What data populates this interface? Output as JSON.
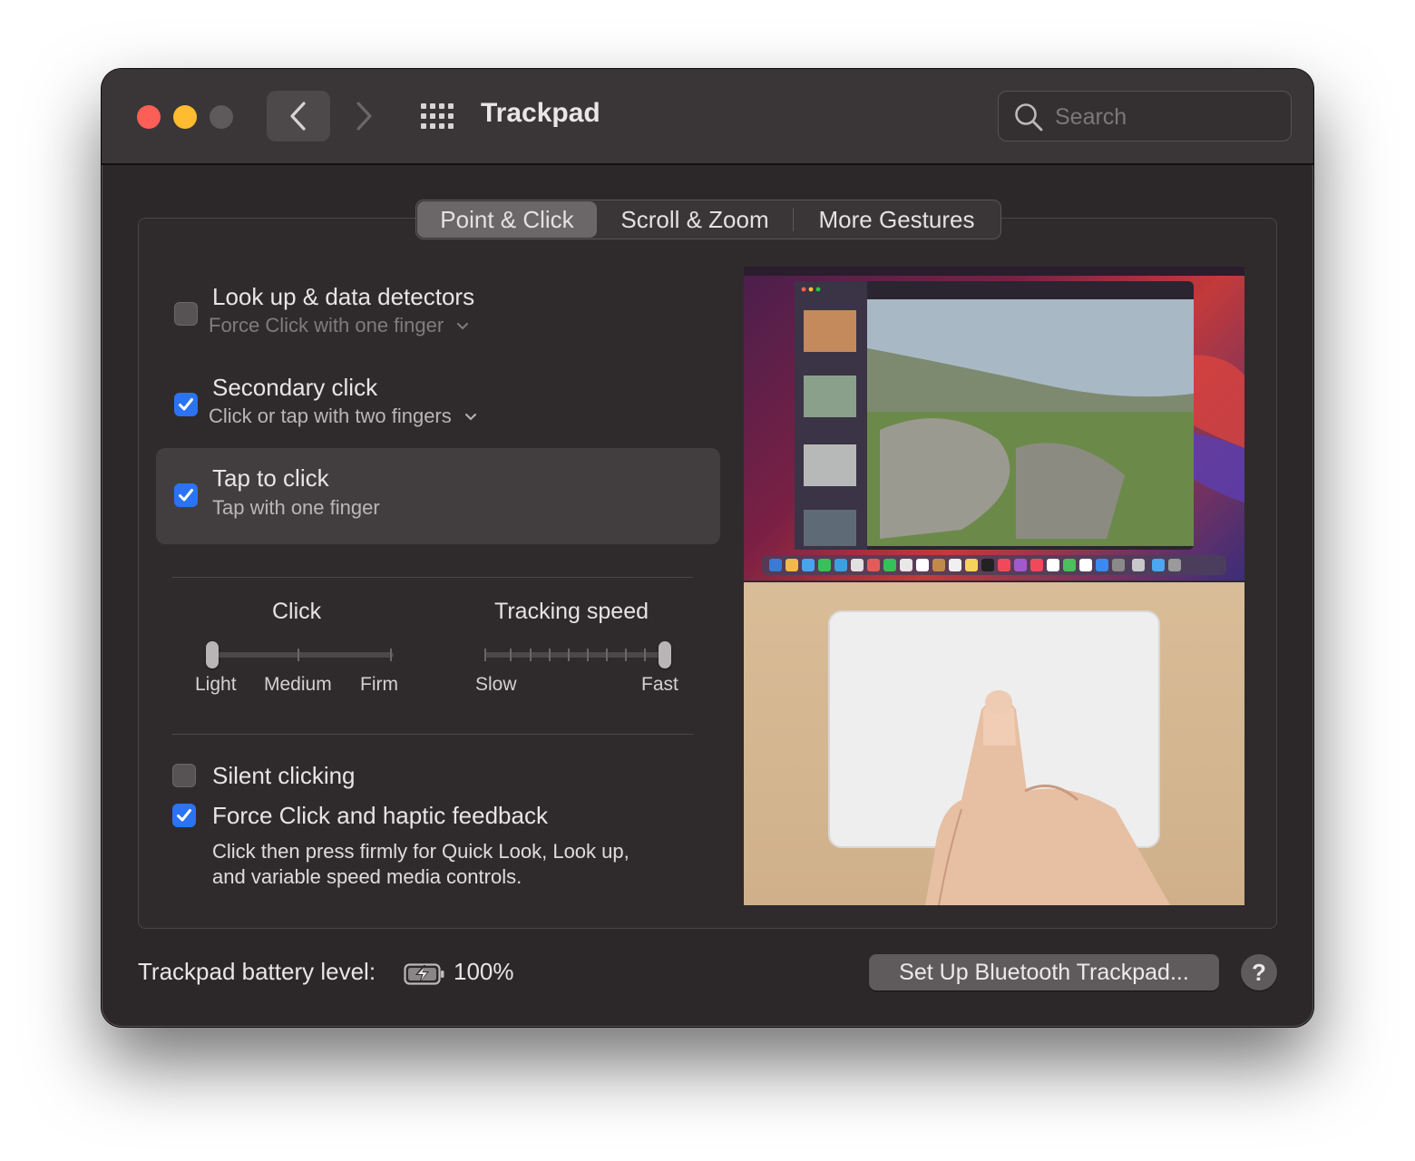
{
  "window": {
    "title": "Trackpad",
    "search": {
      "placeholder": "Search",
      "value": ""
    }
  },
  "tabs": [
    {
      "label": "Point & Click",
      "selected": true
    },
    {
      "label": "Scroll & Zoom",
      "selected": false
    },
    {
      "label": "More Gestures",
      "selected": false
    }
  ],
  "options": {
    "lookup": {
      "label": "Look up & data detectors",
      "sub": "Force Click with one finger",
      "checked": false
    },
    "secondary": {
      "label": "Secondary click",
      "sub": "Click or tap with two fingers",
      "checked": true
    },
    "tap": {
      "label": "Tap to click",
      "sub": "Tap with one finger",
      "checked": true
    },
    "silent": {
      "label": "Silent clicking",
      "checked": false
    },
    "force": {
      "label": "Force Click and haptic feedback",
      "desc_line1": "Click then press firmly for Quick Look, Look up,",
      "desc_line2": "and variable speed media controls.",
      "checked": true
    }
  },
  "sliders": {
    "click": {
      "label": "Click",
      "ticks": [
        "Light",
        "Medium",
        "Firm"
      ],
      "value_index": 0
    },
    "tracking": {
      "label": "Tracking speed",
      "min_label": "Slow",
      "max_label": "Fast",
      "value_fraction": 1.0
    }
  },
  "footer": {
    "battery_label": "Trackpad battery level:",
    "battery_value": "100%",
    "setup_button": "Set Up Bluetooth Trackpad...",
    "help_button": "?"
  },
  "colors": {
    "accent": "#2b73f3",
    "close": "#fd5f57",
    "minimize": "#febc2e",
    "zoom_disabled": "#5e5a5b"
  }
}
